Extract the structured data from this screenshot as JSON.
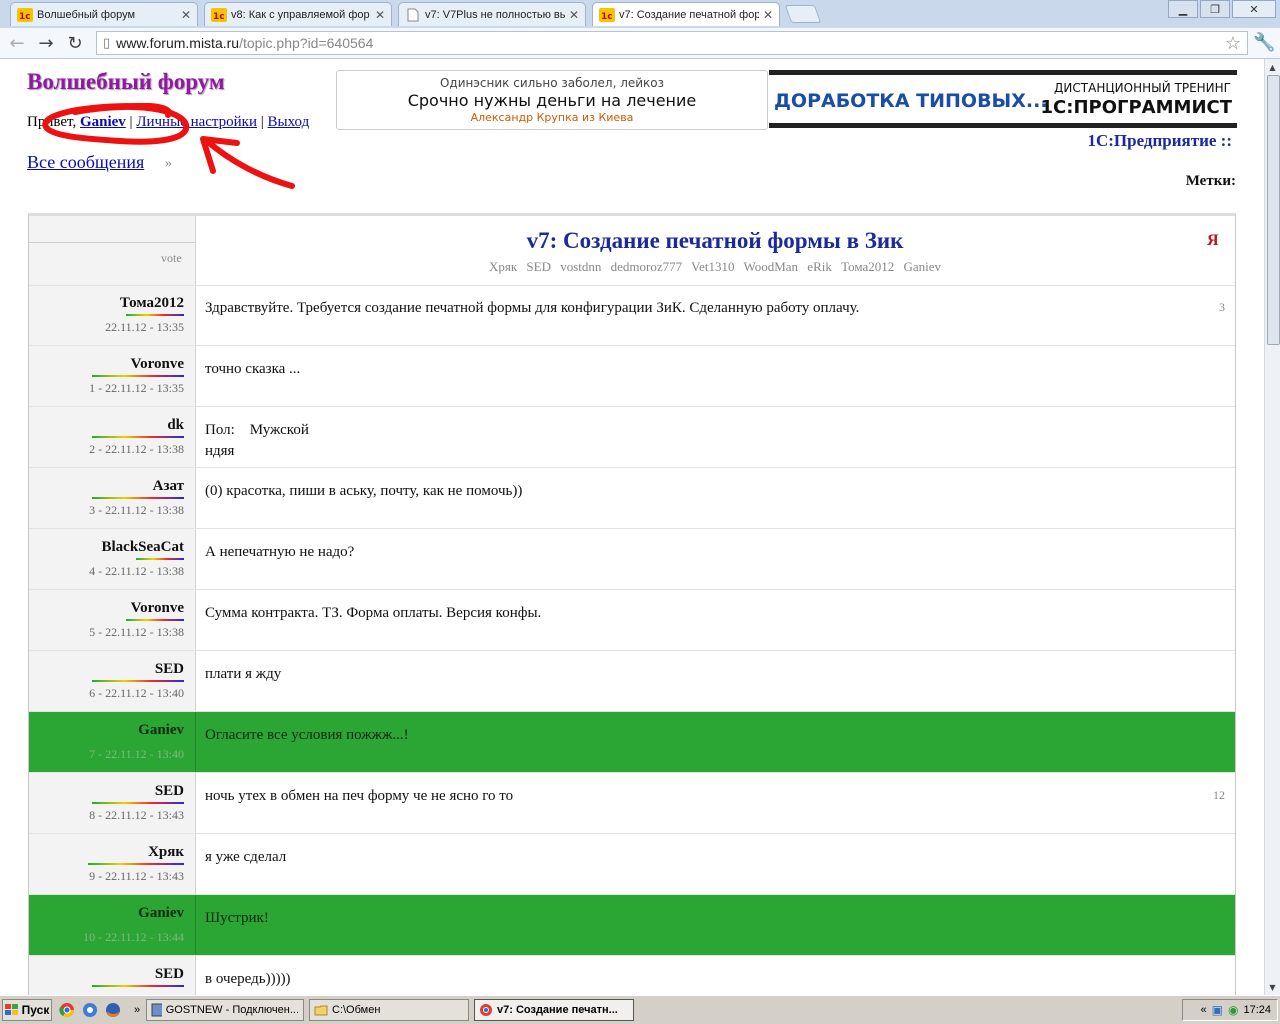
{
  "browser": {
    "tabs": [
      {
        "title": "Волшебный форум"
      },
      {
        "title": "v8: Как с управляемой фор"
      },
      {
        "title": "v7: V7Plus не полностью вы"
      },
      {
        "title": "v7: Создание печатной фор"
      }
    ],
    "address_host": "www.forum.mista.ru",
    "address_path": "/topic.php?id=640564"
  },
  "header": {
    "forum_title": "Волшебный форум",
    "greeting": "Привет,",
    "username": "Ganiev",
    "settings_link": "Личные настройки",
    "logout_link": "Выход",
    "separator": "|",
    "all_messages": "Все сообщения",
    "breadcrumb_sep": "»",
    "enterprise_link": "1С:Предприятие ::",
    "tags_label": "Метки:"
  },
  "ads": {
    "ad1": {
      "line1": "Одинэсник сильно заболел, лейкоз",
      "line2": "Срочно нужны деньги на лечение",
      "line3": "Александр Крупка из Киева"
    },
    "ad2": {
      "big": "ДОРАБОТКА ТИПОВЫХ...",
      "small": "ДИСТАНЦИОННЫЙ ТРЕНИНГ",
      "brand": "1С:ПРОГРАММИСТ"
    }
  },
  "topic": {
    "vote_label": "vote",
    "title": "v7: Создание печатной формы в Зик",
    "participants": "Хряк SED vostdnn dedmoroz777 Vet1310 WoodMan eRik Тома2012 Ganiev",
    "ya": "Я"
  },
  "posts": [
    {
      "author": "Тома2012",
      "meta": "22.11.12 - 13:35",
      "text": "Здравствуйте. Требуется создание печатной формы для конфигурации ЗиК. Сделанную работу оплачу.",
      "num": "3"
    },
    {
      "author": "Voronve",
      "meta": "1 - 22.11.12 - 13:35",
      "text": "точно сказка ..."
    },
    {
      "author": "dk",
      "meta": "2 - 22.11.12 - 13:38",
      "text": "Пол:    Мужской",
      "text2": "ндяя"
    },
    {
      "author": "Азат",
      "meta": "3 - 22.11.12 - 13:38",
      "text": "(0) красотка, пиши в аську, почту, как не помочь))"
    },
    {
      "author": "BlackSeaCat",
      "meta": "4 - 22.11.12 - 13:38",
      "text": "А непечатную не надо?"
    },
    {
      "author": "Voronve",
      "meta": "5 - 22.11.12 - 13:38",
      "text": "Сумма контракта. ТЗ. Форма оплаты. Версия конфы."
    },
    {
      "author": "SED",
      "meta": "6 - 22.11.12 - 13:40",
      "text": "плати я жду"
    },
    {
      "author": "Ganiev",
      "meta": "7 - 22.11.12 - 13:40",
      "text": "Огласите все условия пожжж...!"
    },
    {
      "author": "SED",
      "meta": "8 - 22.11.12 - 13:43",
      "text": "ночь утех в обмен на печ форму че не ясно го то",
      "num": "12"
    },
    {
      "author": "Хряк",
      "meta": "9 - 22.11.12 - 13:43",
      "text": "я уже сделал"
    },
    {
      "author": "Ganiev",
      "meta": "10 - 22.11.12 - 13:44",
      "text": "Шустрик!"
    },
    {
      "author": "SED",
      "meta": "",
      "text": "в очередь)))))"
    }
  ],
  "taskbar": {
    "start": "Пуск",
    "tasks": [
      {
        "label": "GOSTNEW - Подключен..."
      },
      {
        "label": "C:\\Обмен"
      },
      {
        "label": "v7: Создание печатн..."
      }
    ],
    "clock": "17:24"
  }
}
